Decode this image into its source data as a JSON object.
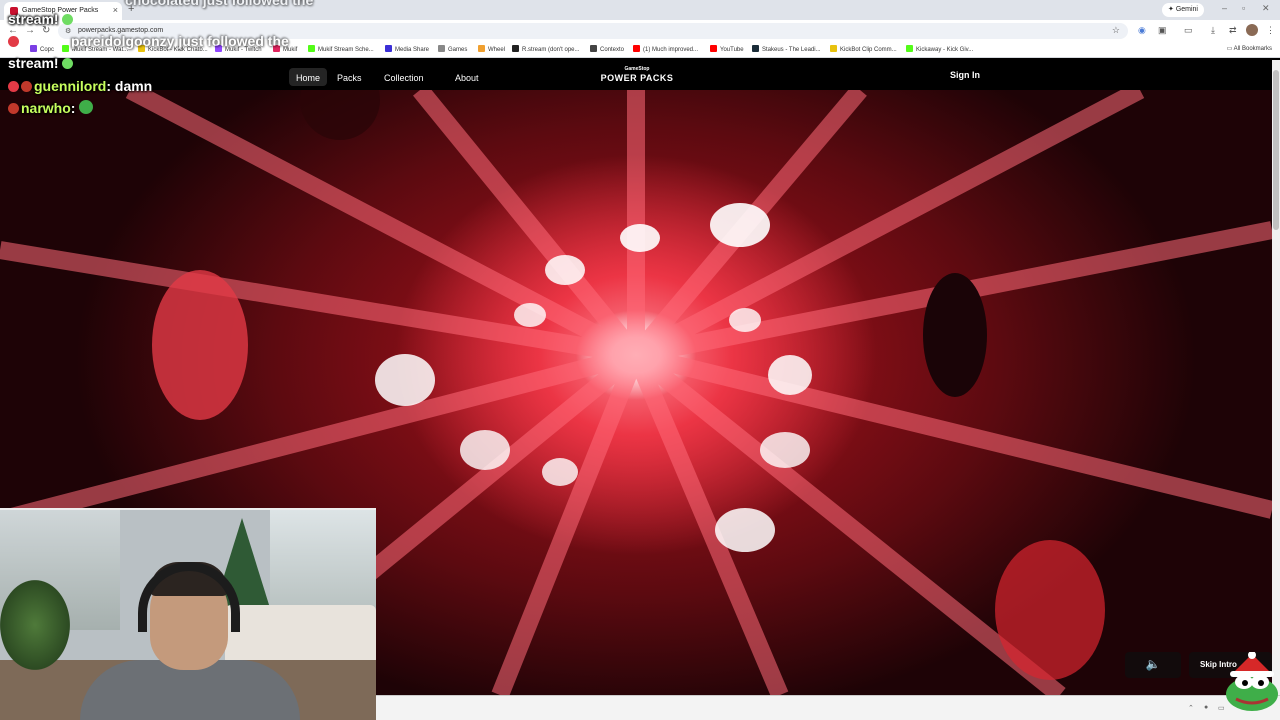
{
  "browser": {
    "tab_title": "GameStop Power Packs",
    "url": "powerpacks.gamestop.com",
    "gemini_label": "Gemini",
    "bookmarks": [
      {
        "label": "Copc",
        "color": "#7b3fe4"
      },
      {
        "label": "Mukif Stream - Wat...",
        "color": "#53fc18"
      },
      {
        "label": "KickBot - Kick Chatb...",
        "color": "#e8c20e"
      },
      {
        "label": "Mukif - Twitch",
        "color": "#9146ff"
      },
      {
        "label": "Mukif",
        "color": "#e0245e"
      },
      {
        "label": "Mukif Stream Sche...",
        "color": "#53fc18"
      },
      {
        "label": "Media Share",
        "color": "#3b2fd6"
      },
      {
        "label": "Games",
        "color": "#888888"
      },
      {
        "label": "Wheel",
        "color": "#f0a030"
      },
      {
        "label": "R.stream (don't ope...",
        "color": "#222222"
      },
      {
        "label": "Contexto",
        "color": "#444444"
      },
      {
        "label": "(1) Much improved...",
        "color": "#ff0000"
      },
      {
        "label": "YouTube",
        "color": "#ff0000"
      },
      {
        "label": "Stakeus - The Leadi...",
        "color": "#1a2c38"
      },
      {
        "label": "KickBot Clip Comm...",
        "color": "#e8c20e"
      },
      {
        "label": "Kickaway - Kick Giv...",
        "color": "#53fc18"
      }
    ],
    "all_bookmarks_label": "All Bookmarks"
  },
  "site": {
    "nav": [
      "Home",
      "Packs",
      "Collection",
      "About"
    ],
    "active_nav": "Home",
    "logo_small": "GameStop",
    "logo_big": "POWER PACKS",
    "sign_in": "Sign In"
  },
  "video": {
    "mute_icon": "speaker-muted-icon",
    "skip_label": "Skip Intro"
  },
  "chat": {
    "lines": [
      {
        "user": "",
        "text": "chocolateu just followed the",
        "faded": true
      },
      {
        "user": "",
        "text": "stream!",
        "emote": "heart",
        "faded": false
      },
      {
        "user": "",
        "text": "pareidolgoonzy just followed the",
        "faded": true
      },
      {
        "user": "",
        "text": "stream!",
        "emote": "heart",
        "faded": false
      },
      {
        "user": "guennilord",
        "text": "damn",
        "faded": false
      },
      {
        "user": "narwho",
        "text": "",
        "emote": "pepe",
        "faded": false
      }
    ]
  },
  "colors": {
    "accent_red": "#c8102e",
    "chat_user": "#c7ff5e",
    "video_core": "#ec3545"
  }
}
